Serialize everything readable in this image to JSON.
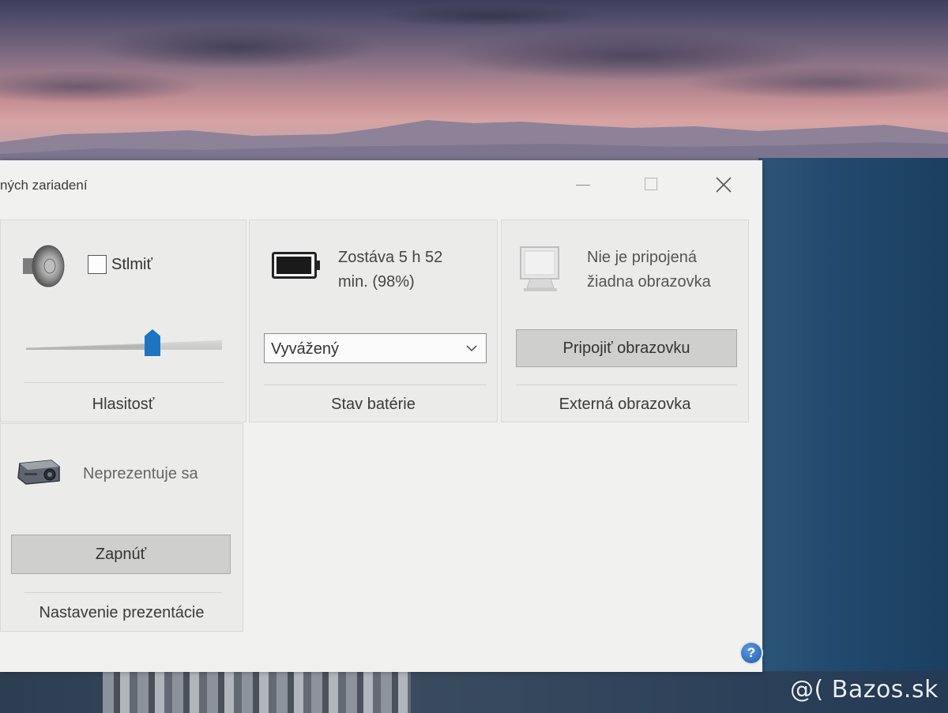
{
  "window": {
    "title": "ných zariadení"
  },
  "volume": {
    "mute_label": "Stlmiť",
    "mute_checked": false,
    "level_fraction": 0.66,
    "tile_title": "Hlasitosť"
  },
  "battery": {
    "status_line1": "Zostáva 5 h 52",
    "status_line2": "min. (98%)",
    "percent": 98,
    "plan_selected": "Vyvážený",
    "tile_title": "Stav batérie"
  },
  "external_display": {
    "status_line1": "Nie je pripojená",
    "status_line2": "žiadna obrazovka",
    "connect_button": "Pripojiť obrazovku",
    "tile_title": "Externá obrazovka"
  },
  "presentation": {
    "status": "Neprezentuje sa",
    "on_button": "Zapnúť",
    "tile_title": "Nastavenie prezentácie"
  },
  "help": {
    "label": "?"
  },
  "watermark": {
    "text": "@( Bazos.sk"
  },
  "colors": {
    "accent": "#1f74c2",
    "window_bg": "#f1f1f0",
    "tile_bg": "#ebebea",
    "button_bg": "#cfcfcd"
  }
}
